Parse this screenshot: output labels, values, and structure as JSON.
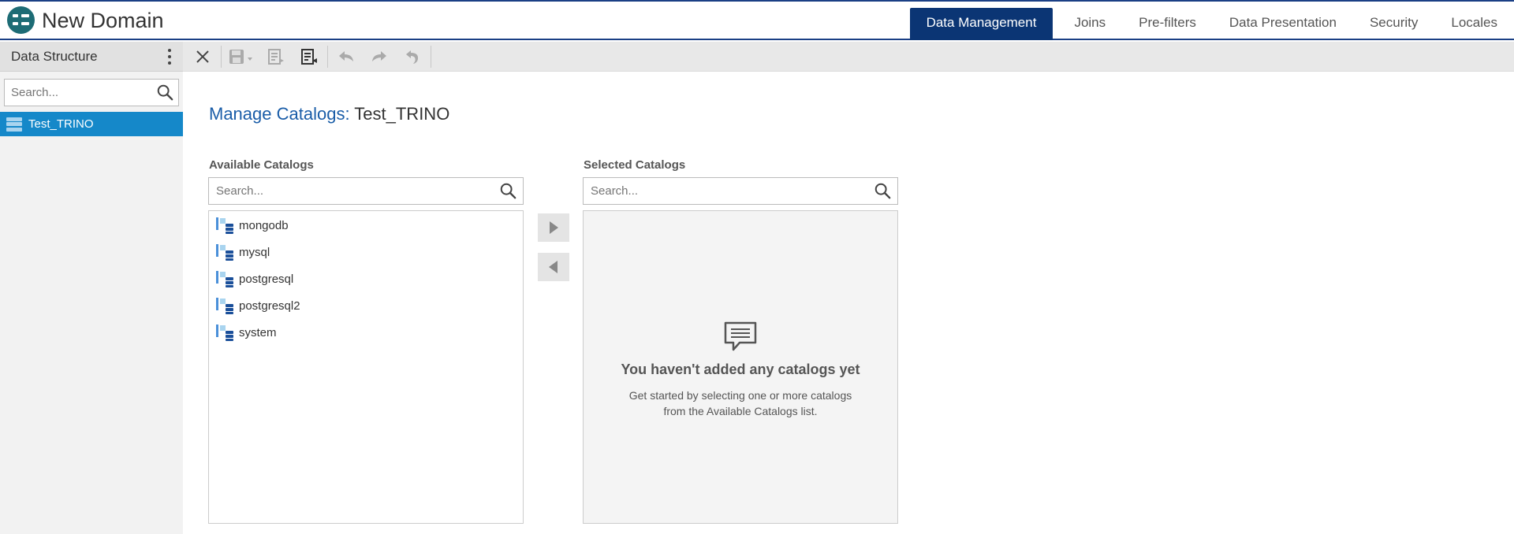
{
  "header": {
    "title": "New Domain",
    "tabs": [
      {
        "label": "Data Management",
        "active": true
      },
      {
        "label": "Joins"
      },
      {
        "label": "Pre-filters"
      },
      {
        "label": "Data Presentation"
      },
      {
        "label": "Security"
      },
      {
        "label": "Locales"
      }
    ]
  },
  "sidebar": {
    "title": "Data Structure",
    "search_placeholder": "Search...",
    "items": [
      {
        "label": "Test_TRINO",
        "selected": true
      }
    ]
  },
  "toolbar": {
    "buttons": [
      "close-icon",
      "save-icon",
      "properties-icon",
      "properties-edit-icon",
      "undo-icon",
      "redo-icon",
      "undo-all-icon"
    ]
  },
  "main": {
    "title_label": "Manage Catalogs:",
    "title_value": "Test_TRINO",
    "available": {
      "label": "Available Catalogs",
      "search_placeholder": "Search...",
      "items": [
        "mongodb",
        "mysql",
        "postgresql",
        "postgresql2",
        "system"
      ]
    },
    "selected": {
      "label": "Selected Catalogs",
      "search_placeholder": "Search...",
      "empty_title": "You haven't added any catalogs yet",
      "empty_line1": "Get started by selecting one or more catalogs",
      "empty_line2": "from the Available Catalogs list."
    }
  },
  "colors": {
    "accent": "#0b3574",
    "selection": "#1588c9",
    "title_blue": "#1a5da8"
  }
}
